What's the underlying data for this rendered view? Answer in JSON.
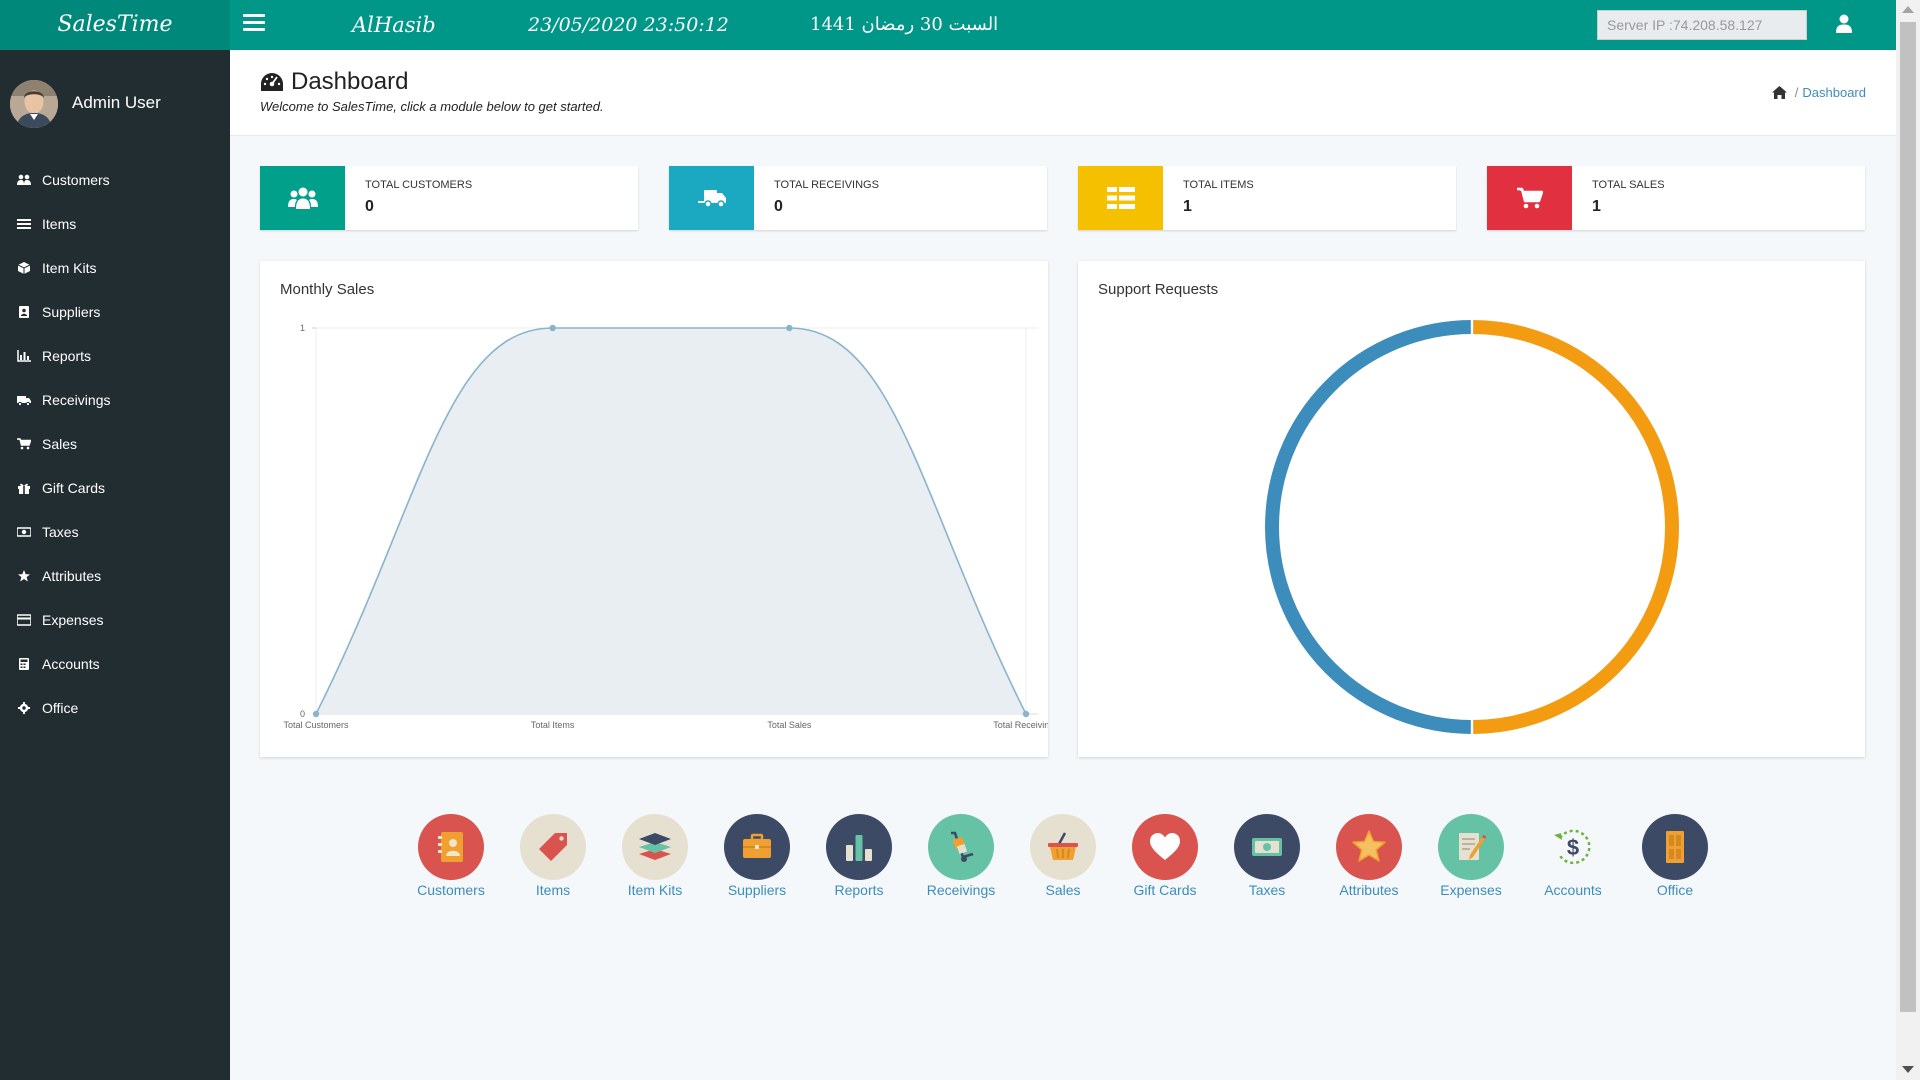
{
  "app": {
    "brand": "SalesTime",
    "company": "AlHasib",
    "datetime": "23/05/2020 23:50:12",
    "hijri_date": "السبت 30 رمضان 1441",
    "server_ip": "Server IP :74.208.58.127"
  },
  "sidebar": {
    "user_name": "Admin User",
    "items": [
      {
        "label": "Customers",
        "icon": "users-icon"
      },
      {
        "label": "Items",
        "icon": "list-icon"
      },
      {
        "label": "Item Kits",
        "icon": "cube-icon"
      },
      {
        "label": "Suppliers",
        "icon": "address-book-icon"
      },
      {
        "label": "Reports",
        "icon": "bar-chart-icon"
      },
      {
        "label": "Receivings",
        "icon": "truck-icon"
      },
      {
        "label": "Sales",
        "icon": "cart-icon"
      },
      {
        "label": "Gift Cards",
        "icon": "gift-icon"
      },
      {
        "label": "Taxes",
        "icon": "money-icon"
      },
      {
        "label": "Attributes",
        "icon": "star-icon"
      },
      {
        "label": "Expenses",
        "icon": "credit-card-icon"
      },
      {
        "label": "Accounts",
        "icon": "calculator-icon"
      },
      {
        "label": "Office",
        "icon": "gear-icon"
      }
    ]
  },
  "header": {
    "title": "Dashboard",
    "subtitle": "Welcome to SalesTime, click a module below to get started.",
    "breadcrumb": "Dashboard"
  },
  "stats": [
    {
      "label": "TOTAL CUSTOMERS",
      "value": "0",
      "color": "#00a08a",
      "icon": "users-icon"
    },
    {
      "label": "TOTAL RECEIVINGS",
      "value": "0",
      "color": "#1aa9c1",
      "icon": "truck-icon"
    },
    {
      "label": "TOTAL ITEMS",
      "value": "1",
      "color": "#f5c000",
      "icon": "list-icon"
    },
    {
      "label": "TOTAL SALES",
      "value": "1",
      "color": "#e1303f",
      "icon": "cart-icon"
    }
  ],
  "panels": {
    "monthly_sales": "Monthly Sales",
    "support_requests": "Support Requests"
  },
  "chart_data": [
    {
      "type": "area",
      "title": "Monthly Sales",
      "categories": [
        "Total Customers",
        "Total Items",
        "Total Sales",
        "Total Receivings"
      ],
      "values": [
        0,
        1,
        1,
        0
      ],
      "yticks": [
        "1",
        "0"
      ],
      "ylim": [
        0,
        1
      ],
      "grid": true,
      "colors": {
        "line": "#8ab4cc",
        "fill": "#e8eef2"
      }
    },
    {
      "type": "pie",
      "title": "Support Requests",
      "slices": [
        {
          "value": 1,
          "color": "#f39c12"
        },
        {
          "value": 1,
          "color": "#3c8dbc"
        }
      ],
      "donut": true
    }
  ],
  "modules": [
    {
      "label": "Customers",
      "icon": "address-book-icon",
      "bg": "#d9534f"
    },
    {
      "label": "Items",
      "icon": "tag-icon",
      "bg": "#e5e0d0"
    },
    {
      "label": "Item Kits",
      "icon": "layers-icon",
      "bg": "#e5e0d0"
    },
    {
      "label": "Suppliers",
      "icon": "briefcase-icon",
      "bg": "#3d4a66"
    },
    {
      "label": "Reports",
      "icon": "bar-chart-icon",
      "bg": "#3d4a66"
    },
    {
      "label": "Receivings",
      "icon": "hand-truck-icon",
      "bg": "#66c2a5"
    },
    {
      "label": "Sales",
      "icon": "basket-icon",
      "bg": "#e5e0d0"
    },
    {
      "label": "Gift Cards",
      "icon": "heart-icon",
      "bg": "#d9534f"
    },
    {
      "label": "Taxes",
      "icon": "banknote-icon",
      "bg": "#3d4a66"
    },
    {
      "label": "Attributes",
      "icon": "star-icon",
      "bg": "#d9534f"
    },
    {
      "label": "Expenses",
      "icon": "pencil-document-icon",
      "bg": "#66c2a5"
    },
    {
      "label": "Accounts",
      "icon": "dollar-refresh-icon",
      "bg": "transparent"
    },
    {
      "label": "Office",
      "icon": "door-icon",
      "bg": "#3d4a66"
    }
  ]
}
